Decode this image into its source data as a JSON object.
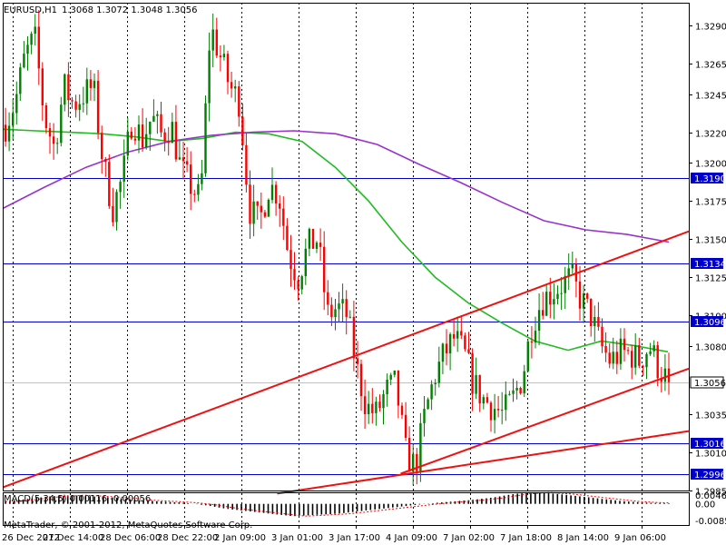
{
  "header": {
    "symbol": "EURUSD,H1",
    "quote": "1.3068 1.3072 1.3048 1.3056"
  },
  "indicator": {
    "label": "MACD(5,34,5) 0.00116 -0.00056",
    "ticks": [
      "0.00466",
      "0.00",
      "-0.00856"
    ]
  },
  "copyright": "MetaTrader, © 2001-2012, MetaQuotes Software Corp.",
  "colors": {
    "bull": "#008000",
    "bear": "#ff0000",
    "ma_fast": "#22bb22",
    "ma_slow": "#9933cc",
    "trend": "#ee1111",
    "level": "#0000cc",
    "price_label_bg": "#ffffff",
    "level_label_bg": "#0000cc"
  },
  "chart_data": {
    "type": "candlestick",
    "title": "EURUSD,H1",
    "ylim": [
      1.2985,
      1.3305
    ],
    "y_ticks": [
      1.329,
      1.3265,
      1.3245,
      1.322,
      1.32,
      1.3175,
      1.315,
      1.3125,
      1.31,
      1.308,
      1.3035,
      1.301,
      1.2985
    ],
    "y_tick_labels": [
      "1.3290",
      "1.3265",
      "1.3245",
      "1.3220",
      "1.3200",
      "1.3175",
      "1.3150",
      "1.3125",
      "1.3100",
      "1.3080",
      "1.3035",
      "1.3010",
      "1.2985"
    ],
    "x_tick_labels": [
      "26 Dec 2012",
      "27 Dec 14:00",
      "28 Dec 06:00",
      "28 Dec 22:00",
      "2 Jan 09:00",
      "3 Jan 01:00",
      "3 Jan 17:00",
      "4 Jan 09:00",
      "7 Jan 02:00",
      "7 Jan 18:00",
      "8 Jan 14:00",
      "9 Jan 06:00"
    ],
    "current_price": 1.3056,
    "current_price_label": "1.3056",
    "horizontal_levels": [
      1.319,
      1.3134,
      1.3096,
      1.3016,
      1.2996
    ],
    "horizontal_level_labels": [
      "1.3190",
      "1.3134",
      "1.3096",
      "1.3016",
      "1.2996"
    ],
    "close_path": [
      1.3225,
      1.324,
      1.327,
      1.3282,
      1.323,
      1.321,
      1.325,
      1.3238,
      1.3245,
      1.325,
      1.32,
      1.317,
      1.319,
      1.323,
      1.3215,
      1.323,
      1.3218,
      1.3225,
      1.3195,
      1.3185,
      1.3175,
      1.329,
      1.327,
      1.325,
      1.324,
      1.317,
      1.316,
      1.3185,
      1.318,
      1.314,
      1.3125,
      1.3145,
      1.315,
      1.31,
      1.3105,
      1.31,
      1.3065,
      1.304,
      1.3035,
      1.305,
      1.3055,
      1.301,
      1.3,
      1.3035,
      1.306,
      1.3075,
      1.3085,
      1.3075,
      1.3055,
      1.3045,
      1.304,
      1.3035,
      1.3045,
      1.306,
      1.3095,
      1.311,
      1.3115,
      1.312,
      1.3125,
      1.311,
      1.31,
      1.308,
      1.307,
      1.3075,
      1.3075,
      1.307,
      1.308,
      1.3065,
      1.3056
    ],
    "series": [
      {
        "name": "",
        "role": "ma_fast",
        "values": [
          1.3222,
          1.3221,
          1.322,
          1.3219,
          1.3217,
          1.3214,
          1.3216,
          1.322,
          1.3219,
          1.3214,
          1.3197,
          1.3175,
          1.3148,
          1.3125,
          1.3108,
          1.3095,
          1.3083,
          1.3077,
          1.3083,
          1.308,
          1.3076
        ]
      },
      {
        "name": "",
        "role": "ma_slow",
        "values": [
          1.317,
          1.3184,
          1.3197,
          1.3207,
          1.3214,
          1.3218,
          1.322,
          1.3221,
          1.3219,
          1.3212,
          1.3199,
          1.3187,
          1.3174,
          1.3162,
          1.3156,
          1.3153,
          1.3148
        ]
      }
    ],
    "trendlines": [
      {
        "x": [
          0.0,
          1.0
        ],
        "y": [
          1.2987,
          1.3155
        ]
      },
      {
        "x": [
          0.58,
          1.0
        ],
        "y": [
          1.2996,
          1.3065
        ]
      },
      {
        "x": [
          0.4,
          1.0
        ],
        "y": [
          1.2983,
          1.3024
        ]
      }
    ],
    "macd": {
      "ylim": [
        -0.00856,
        0.00466
      ],
      "histogram": [
        0.001,
        0.002,
        0.003,
        0.0035,
        0.003,
        0.0025,
        0.0015,
        0.001,
        0.0005,
        -0.0005,
        -0.002,
        -0.003,
        -0.004,
        -0.005,
        -0.0045,
        -0.004,
        -0.003,
        -0.002,
        -0.001,
        0.0,
        0.0008,
        0.0015,
        0.0025,
        0.004,
        0.0046,
        0.004,
        0.003,
        0.002,
        0.001,
        0.0005,
        0.0002
      ]
    }
  }
}
